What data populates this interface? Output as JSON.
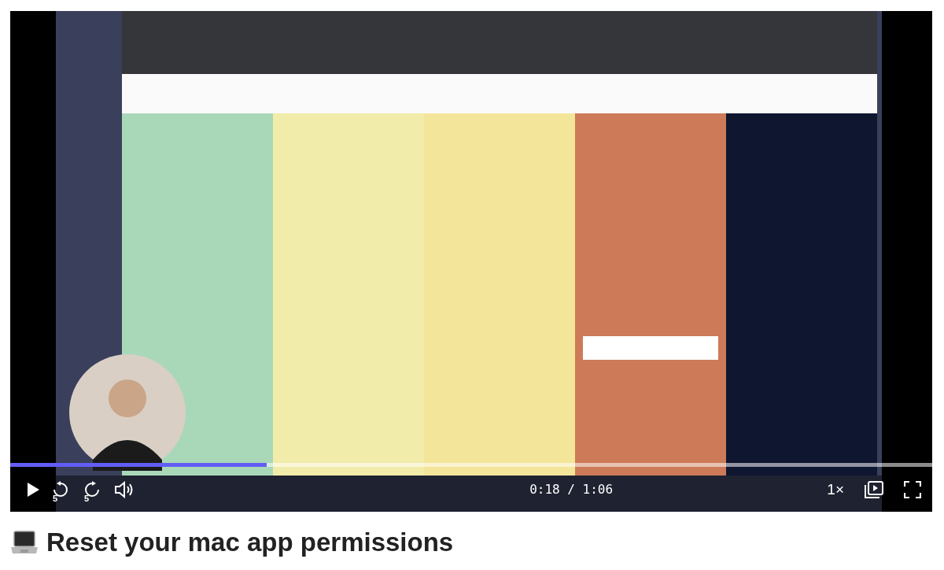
{
  "video": {
    "kind": "picture",
    "progress": {
      "level": 0.278
    },
    "controls": {
      "rewind_seconds": "5",
      "forward_seconds": "5",
      "time": "0:18 / 1:06",
      "speed": "1×"
    }
  },
  "title": "Reset your mac app permissions"
}
